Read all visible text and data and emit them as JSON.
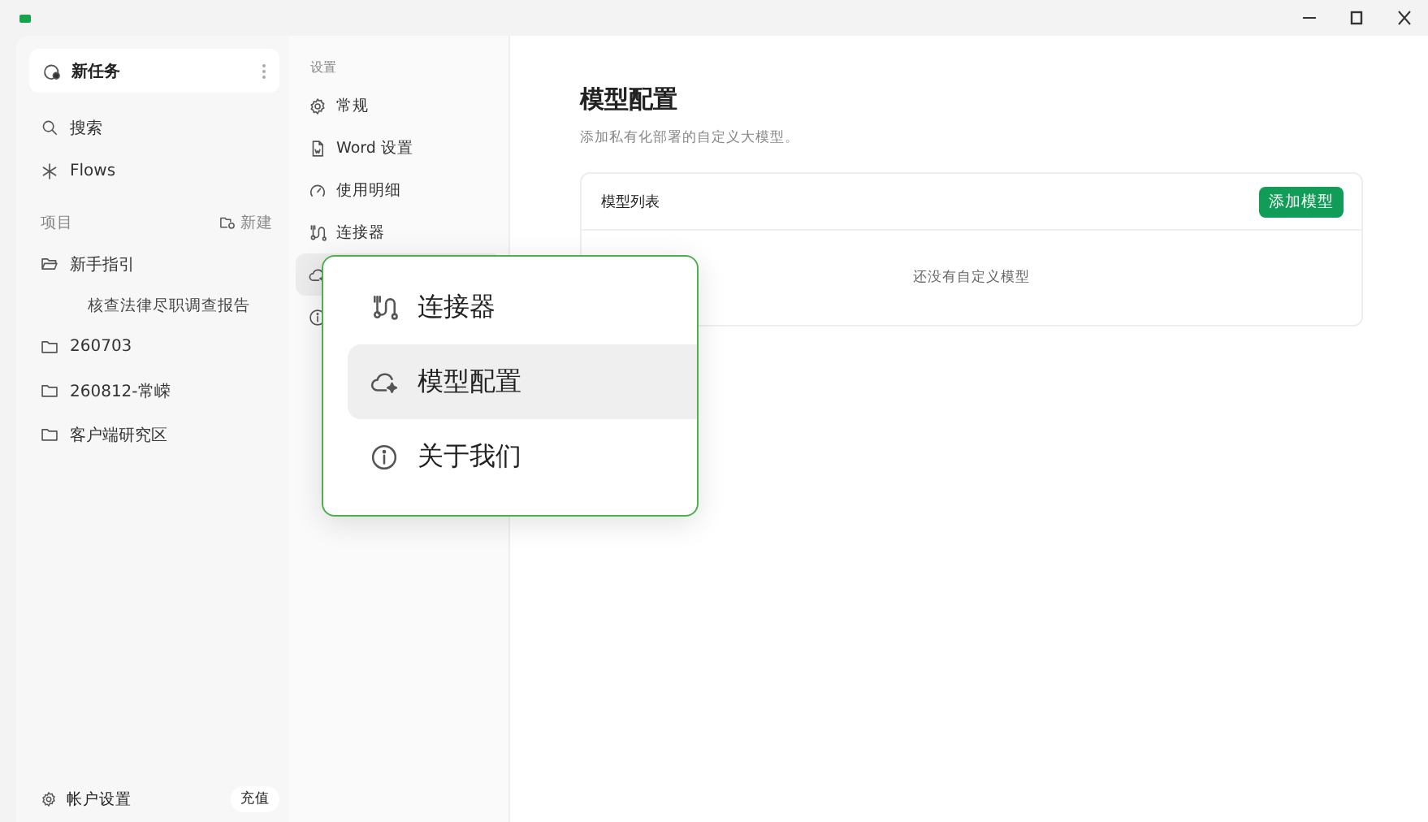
{
  "sidebar": {
    "new_task": {
      "label": "新任务"
    },
    "nav": [
      {
        "label": "搜索"
      },
      {
        "label": "Flows"
      }
    ],
    "projects": {
      "title": "项目",
      "new_label": "新建",
      "items": [
        {
          "label": "新手指引",
          "expanded": true,
          "children": [
            {
              "label": "核查法律尽职调查报告"
            }
          ]
        },
        {
          "label": "260703",
          "expanded": false
        },
        {
          "label": "260812-常嵘",
          "expanded": false
        },
        {
          "label": "客户端研究区",
          "expanded": false
        }
      ]
    },
    "footer": {
      "account": "帐户设置",
      "recharge": "充值"
    }
  },
  "settings_nav": {
    "title": "设置",
    "items": [
      {
        "label": "常规",
        "selected": false
      },
      {
        "label": "Word 设置",
        "selected": false
      },
      {
        "label": "使用明细",
        "selected": false
      },
      {
        "label": "连接器",
        "selected": false
      },
      {
        "selected": true
      },
      {
        "selected": false
      }
    ]
  },
  "main": {
    "title": "模型配置",
    "subtitle": "添加私有化部署的自定义大模型。",
    "card": {
      "title": "模型列表",
      "add_button": "添加模型",
      "empty_text": "还没有自定义模型"
    }
  },
  "popup": {
    "items": [
      {
        "label": "连接器",
        "selected": false
      },
      {
        "label": "模型配置",
        "selected": true
      },
      {
        "label": "关于我们",
        "selected": false
      }
    ]
  }
}
